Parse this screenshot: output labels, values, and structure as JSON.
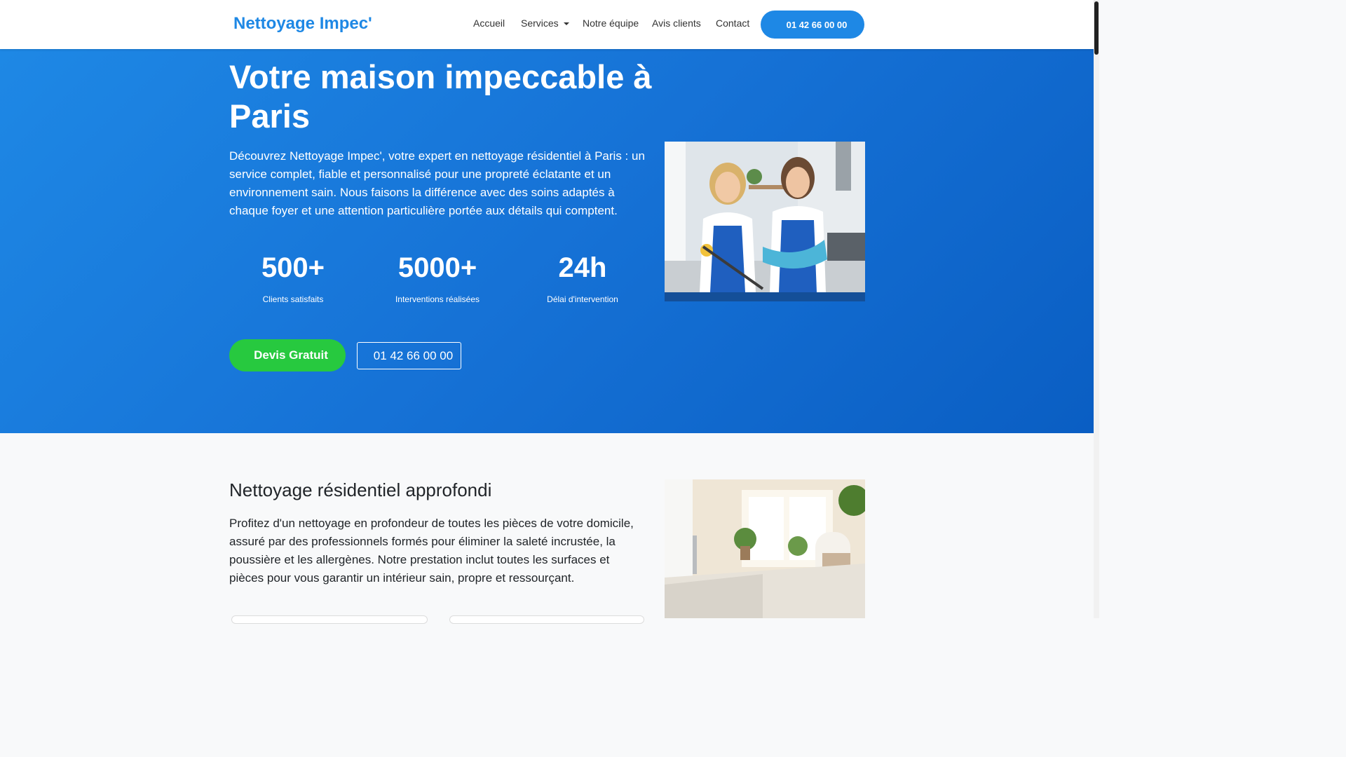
{
  "nav": {
    "brand": "Nettoyage Impec'",
    "links": [
      "Accueil",
      "Services",
      "Notre équipe",
      "Avis clients",
      "Contact"
    ],
    "phone_button": "01 42 66 00 00"
  },
  "hero": {
    "title": "Votre maison impeccable à Paris",
    "description": "Découvrez Nettoyage Impec', votre expert en nettoyage résidentiel à Paris : un service complet, fiable et personnalisé pour une propreté éclatante et un environnement sain. Nous faisons la différence avec des soins adaptés à chaque foyer et une attention particulière portée aux détails qui comptent.",
    "stats": [
      {
        "value": "500+",
        "label": "Clients satisfaits"
      },
      {
        "value": "5000+",
        "label": "Interventions réalisées"
      },
      {
        "value": "24h",
        "label": "Délai d'intervention"
      }
    ],
    "cta_quote": "Devis Gratuit",
    "cta_phone": "01 42 66 00 00"
  },
  "section": {
    "title": "Nettoyage résidentiel approfondi",
    "text": "Profitez d'un nettoyage en profondeur de toutes les pièces de votre domicile, assuré par des professionnels formés pour éliminer la saleté incrustée, la poussière et les allergènes. Notre prestation inclut toutes les surfaces et pièces pour vous garantir un intérieur sain, propre et ressourçant."
  },
  "colors": {
    "primary": "#1e88e5",
    "hero_dark": "#0a5ec3",
    "cta_green": "#27c93f"
  },
  "icons": [
    "phone-icon",
    "file-icon",
    "caret-down-icon"
  ]
}
